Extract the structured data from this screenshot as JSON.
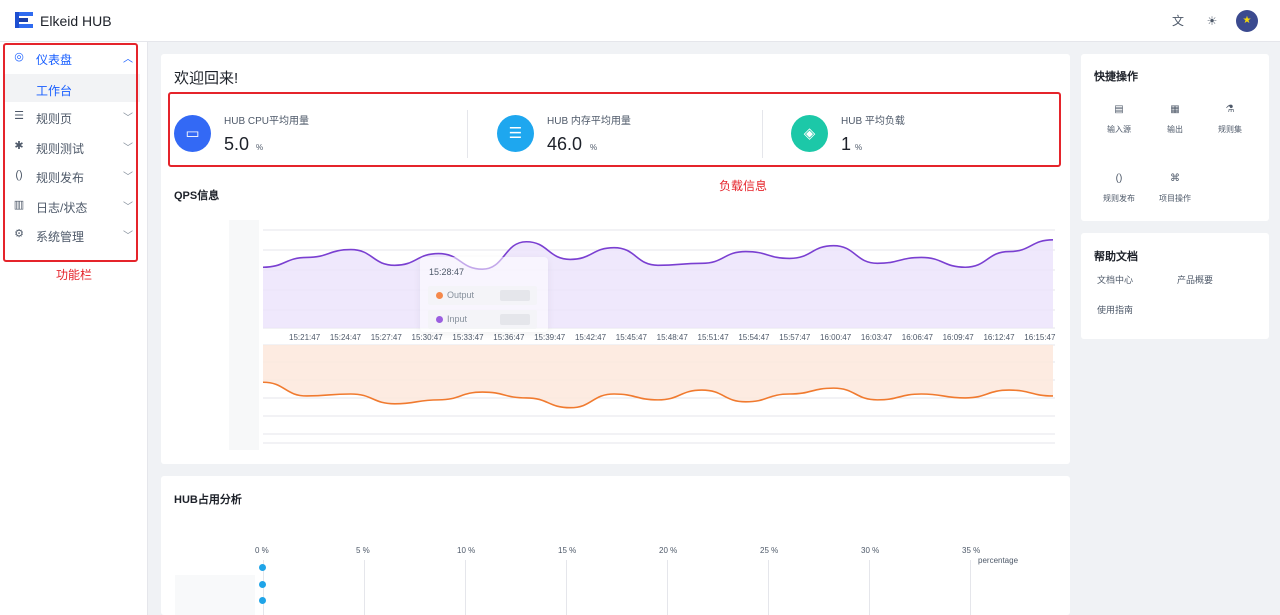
{
  "app": {
    "title": "Elkeid HUB"
  },
  "sidebar": {
    "items": [
      {
        "label": "仪表盘",
        "icon": "dashboard-icon"
      },
      {
        "label": "规则页",
        "icon": "list-icon"
      },
      {
        "label": "规则测试",
        "icon": "bug-icon"
      },
      {
        "label": "规则发布",
        "icon": "brackets-icon"
      },
      {
        "label": "日志/状态",
        "icon": "bar-chart-icon"
      },
      {
        "label": "系统管理",
        "icon": "gear-icon"
      }
    ],
    "subitem": "工作台",
    "annotation": "功能栏"
  },
  "welcome": "欢迎回来!",
  "metrics": [
    {
      "label": "HUB CPU平均用量",
      "value": "5.0",
      "unit": "%",
      "color": "#3369f5"
    },
    {
      "label": "HUB 内存平均用量",
      "value": "46.0",
      "unit": "%",
      "color": "#1ea7ef"
    },
    {
      "label": "HUB 平均负载",
      "value": "1",
      "unit": "%",
      "color": "#1cc8a8"
    }
  ],
  "metrics_annotation": "负载信息",
  "qps": {
    "title": "QPS信息",
    "tooltip": {
      "time": "15:28:47",
      "rows": [
        {
          "name": "Output",
          "color": "#f5894b"
        },
        {
          "name": "Input",
          "color": "#9b5fe0"
        }
      ]
    }
  },
  "chart_data": {
    "type": "area",
    "x": [
      "15:21:47",
      "15:24:47",
      "15:27:47",
      "15:30:47",
      "15:33:47",
      "15:36:47",
      "15:39:47",
      "15:42:47",
      "15:45:47",
      "15:48:47",
      "15:51:47",
      "15:54:47",
      "15:57:47",
      "16:00:47",
      "16:03:47",
      "16:06:47",
      "16:09:47",
      "16:12:47",
      "16:15:47"
    ],
    "series": [
      {
        "name": "Input",
        "color": "#7a3fd1",
        "values": [
          62,
          72,
          80,
          64,
          76,
          60,
          88,
          70,
          82,
          64,
          66,
          78,
          71,
          84,
          66,
          72,
          62,
          78,
          90
        ]
      },
      {
        "name": "Output",
        "color": "#f07a2f",
        "values": [
          62,
          48,
          50,
          40,
          44,
          52,
          46,
          36,
          50,
          44,
          54,
          42,
          50,
          56,
          44,
          50,
          46,
          54,
          48
        ]
      }
    ],
    "grid": true
  },
  "usage": {
    "title": "HUB占用分析",
    "xticks": [
      "0 %",
      "5 %",
      "10 %",
      "15 %",
      "20 %",
      "25 %",
      "30 %",
      "35 %"
    ],
    "xlabel": "percentage"
  },
  "quick_actions": {
    "title": "快捷操作",
    "items": [
      {
        "label": "输入源",
        "icon": "file-icon"
      },
      {
        "label": "输出",
        "icon": "table-icon"
      },
      {
        "label": "规则集",
        "icon": "flask-icon"
      },
      {
        "label": "规则发布",
        "icon": "brackets-icon"
      },
      {
        "label": "项目操作",
        "icon": "command-icon"
      }
    ]
  },
  "help": {
    "title": "帮助文档",
    "links": [
      "文档中心",
      "产品概要",
      "使用指南"
    ]
  }
}
